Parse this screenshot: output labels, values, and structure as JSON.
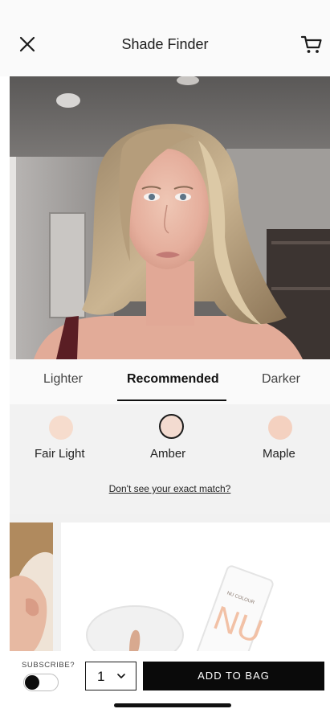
{
  "header": {
    "title": "Shade Finder",
    "close_icon": "close-icon",
    "cart_icon": "cart-icon"
  },
  "tabs": [
    {
      "label": "Lighter",
      "active": false
    },
    {
      "label": "Recommended",
      "active": true
    },
    {
      "label": "Darker",
      "active": false
    }
  ],
  "shades": [
    {
      "name": "Fair Light",
      "color": "#f6dccd",
      "selected": false
    },
    {
      "name": "Amber",
      "color": "#f3dbd0",
      "selected": true
    },
    {
      "name": "Maple",
      "color": "#f4d1c0",
      "selected": false
    }
  ],
  "no_match_link": "Don't see your exact match?",
  "product_brand": "NU COLOUR",
  "product_letters": "NU",
  "purchase": {
    "subscribe_label": "SUBSCRIBE?",
    "subscribe_on": false,
    "quantity": "1",
    "add_to_bag": "ADD TO BAG"
  },
  "colors": {
    "accent": "#0a0a0a",
    "swatch_selected_border": "#1c1c1c"
  }
}
